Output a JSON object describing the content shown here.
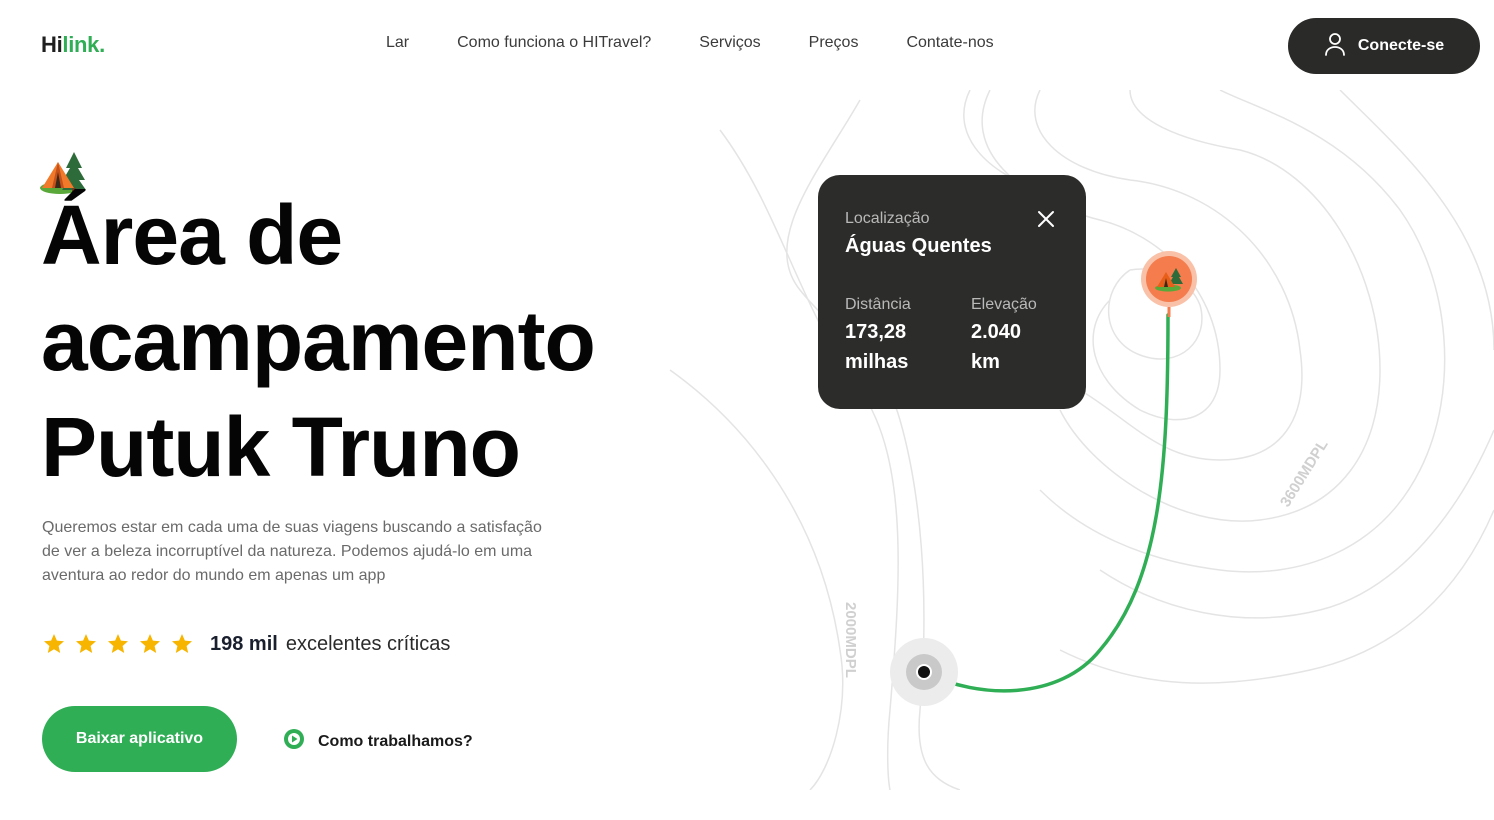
{
  "header": {
    "logo_hi": "Hi",
    "logo_link": "link.",
    "nav": [
      {
        "label": "Lar"
      },
      {
        "label": "Como funciona o HITravel?"
      },
      {
        "label": "Serviços"
      },
      {
        "label": "Preços"
      },
      {
        "label": "Contate-nos"
      }
    ],
    "connect_label": "Conecte-se"
  },
  "hero": {
    "title_lines": [
      "Área de",
      "acampamento",
      "Putuk Truno"
    ],
    "description": "Queremos estar em cada uma de suas viagens buscando a satisfação de ver a beleza incorruptível da natureza. Podemos ajudá-lo em uma aventura ao redor do mundo em apenas um app",
    "rating": {
      "stars": 5,
      "count": "198 mil",
      "label": "excelentes críticas"
    },
    "download_label": "Baixar aplicativo",
    "how_label": "Como trabalhamos?"
  },
  "map_card": {
    "location_label": "Localização",
    "location_value": "Águas Quentes",
    "distance_label": "Distância",
    "distance_value_line1": "173,28",
    "distance_value_line2": "milhas",
    "elevation_label": "Elevação",
    "elevation_value_line1": "2.040",
    "elevation_value_line2": "km"
  },
  "map_labels": {
    "contour_a": "3600MDPL",
    "contour_b": "2000MDPL"
  },
  "colors": {
    "accent": "#2fae55",
    "dark": "#2a2b28",
    "pin": "#f47c4d",
    "star": "#f7b500"
  }
}
